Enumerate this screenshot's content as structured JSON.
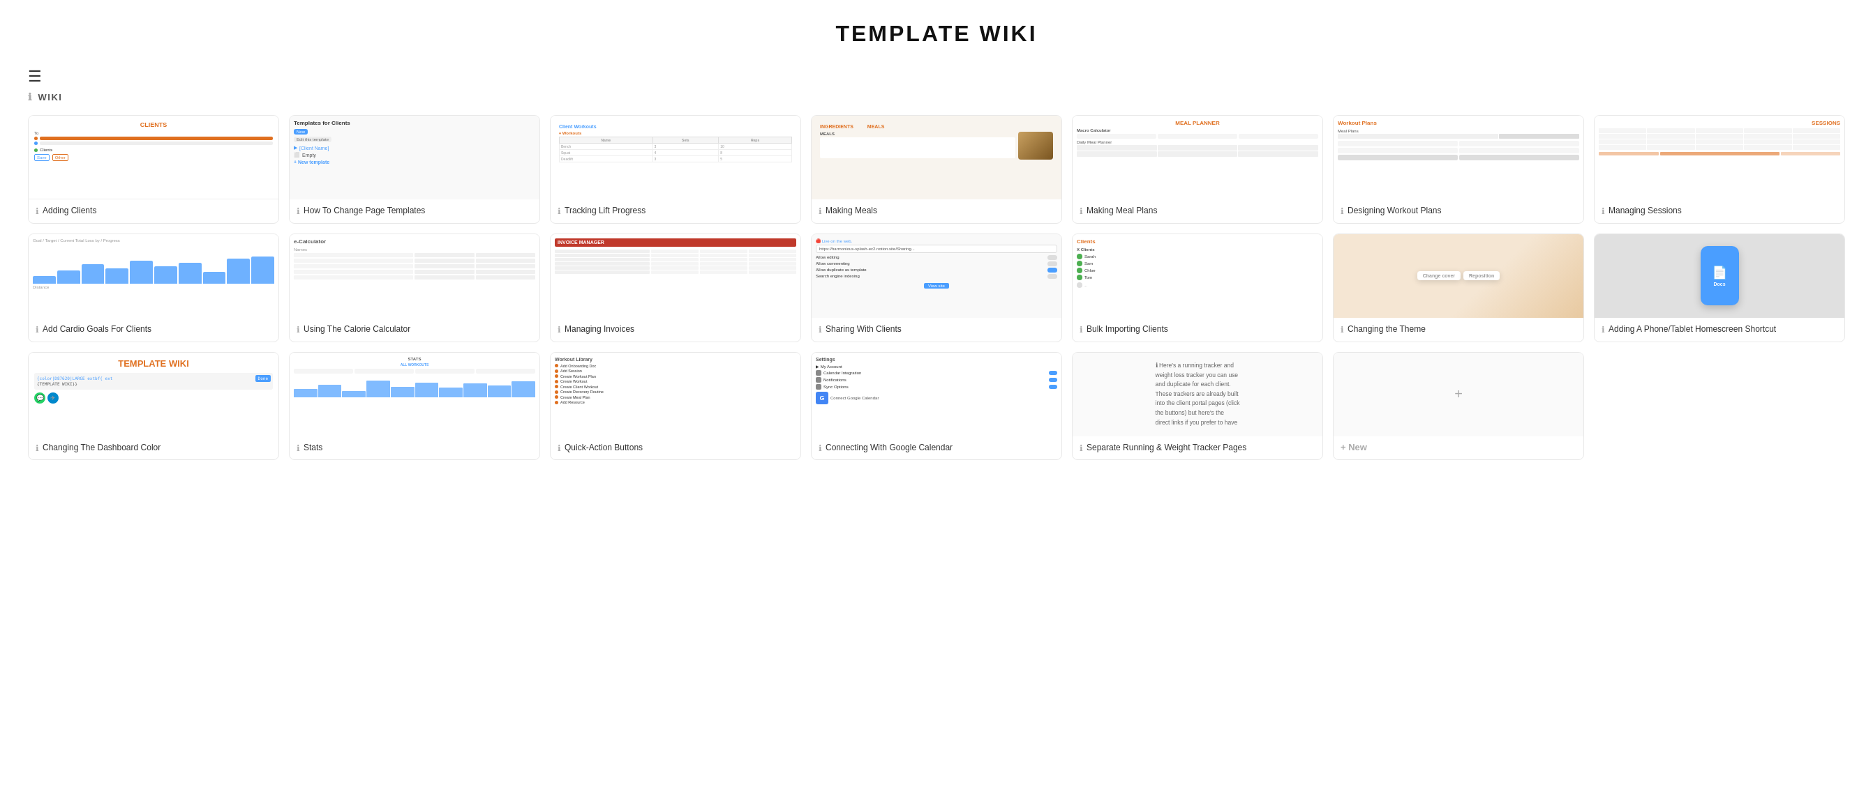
{
  "page": {
    "title": "TEMPLATE WIKI",
    "section": "WIKI"
  },
  "cards": [
    {
      "id": "adding-clients",
      "label": "Adding Clients",
      "thumb_type": "clients"
    },
    {
      "id": "how-to-change-templates",
      "label": "How To Change Page Templates",
      "thumb_type": "template"
    },
    {
      "id": "tracking-lift-progress",
      "label": "Tracking Lift Progress",
      "thumb_type": "workout"
    },
    {
      "id": "making-meals",
      "label": "Making Meals",
      "thumb_type": "meals"
    },
    {
      "id": "making-meal-plans",
      "label": "Making Meal Plans",
      "thumb_type": "mealplan"
    },
    {
      "id": "designing-workout-plans",
      "label": "Designing Workout Plans",
      "thumb_type": "designworkout"
    },
    {
      "id": "managing-sessions",
      "label": "Managing Sessions",
      "thumb_type": "sessions"
    },
    {
      "id": "add-cardio-goals",
      "label": "Add Cardio Goals For Clients",
      "thumb_type": "cardio"
    },
    {
      "id": "calorie-calculator",
      "label": "Using The Calorie Calculator",
      "thumb_type": "calorie"
    },
    {
      "id": "managing-invoices",
      "label": "Managing Invoices",
      "thumb_type": "invoice"
    },
    {
      "id": "sharing-with-clients",
      "label": "Sharing With Clients",
      "thumb_type": "sharing"
    },
    {
      "id": "bulk-importing",
      "label": "Bulk Importing Clients",
      "thumb_type": "bulk"
    },
    {
      "id": "changing-theme",
      "label": "Changing the Theme",
      "thumb_type": "theme"
    },
    {
      "id": "phone-shortcut",
      "label": "Adding A Phone/Tablet Homescreen Shortcut",
      "thumb_type": "phone"
    },
    {
      "id": "dashboard-color",
      "label": "Changing The Dashboard Color",
      "thumb_type": "dashboard"
    },
    {
      "id": "stats",
      "label": "Stats",
      "thumb_type": "stats"
    },
    {
      "id": "quick-action-buttons",
      "label": "Quick-Action Buttons",
      "thumb_type": "quickaction"
    },
    {
      "id": "google-calendar",
      "label": "Connecting With Google Calendar",
      "thumb_type": "gcal"
    },
    {
      "id": "running-tracker",
      "label": "Separate Running & Weight Tracker Pages",
      "thumb_type": "running"
    },
    {
      "id": "new-card",
      "label": "New",
      "thumb_type": "new"
    }
  ],
  "new_button_label": "+ New"
}
